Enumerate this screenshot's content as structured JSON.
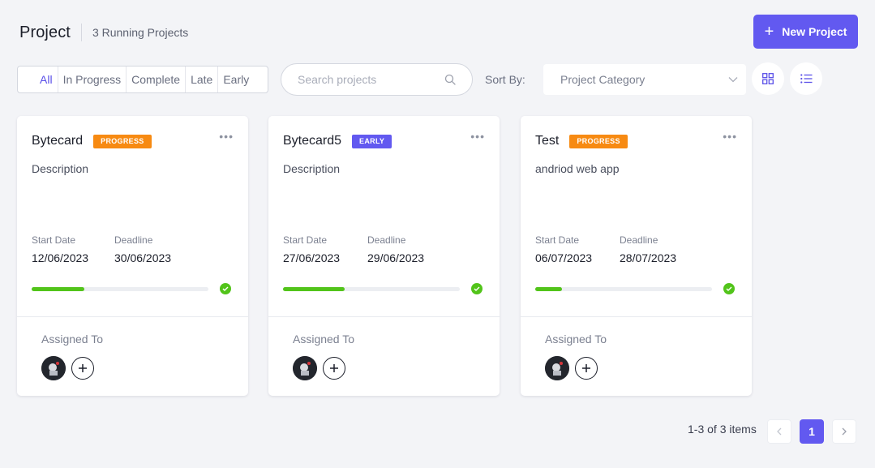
{
  "header": {
    "title": "Project",
    "running": "3 Running Projects",
    "new_button": "New Project"
  },
  "filters": [
    "All",
    "In Progress",
    "Complete",
    "Late",
    "Early"
  ],
  "active_filter": "All",
  "search": {
    "placeholder": "Search projects"
  },
  "sort": {
    "label": "Sort By:",
    "selected": "Project Category"
  },
  "icons": {
    "search": "search-icon",
    "dropdown": "chevron-down-icon",
    "grid": "grid-view-icon",
    "list": "list-view-icon",
    "menu": "more-horizontal-icon",
    "check": "check-circle-icon",
    "add": "plus-circle-icon"
  },
  "colors": {
    "accent": "#6259f0",
    "progress_badge": "#f78a12",
    "early_badge": "#6259f0",
    "bar": "#52c41a"
  },
  "cards": [
    {
      "title": "Bytecard",
      "badge": "PROGRESS",
      "badge_type": "progress",
      "description": "Description",
      "start_label": "Start Date",
      "start": "12/06/2023",
      "deadline_label": "Deadline",
      "deadline": "30/06/2023",
      "progress": 0.3,
      "assigned_label": "Assigned To"
    },
    {
      "title": "Bytecard5",
      "badge": "EARLY",
      "badge_type": "early",
      "description": "Description",
      "start_label": "Start Date",
      "start": "27/06/2023",
      "deadline_label": "Deadline",
      "deadline": "29/06/2023",
      "progress": 0.35,
      "assigned_label": "Assigned To"
    },
    {
      "title": "Test",
      "badge": "PROGRESS",
      "badge_type": "progress",
      "description": "andriod web app",
      "start_label": "Start Date",
      "start": "06/07/2023",
      "deadline_label": "Deadline",
      "deadline": "28/07/2023",
      "progress": 0.15,
      "assigned_label": "Assigned To"
    }
  ],
  "pagination": {
    "summary": "1-3 of 3 items",
    "current": "1",
    "prev": "<",
    "next": ">"
  }
}
